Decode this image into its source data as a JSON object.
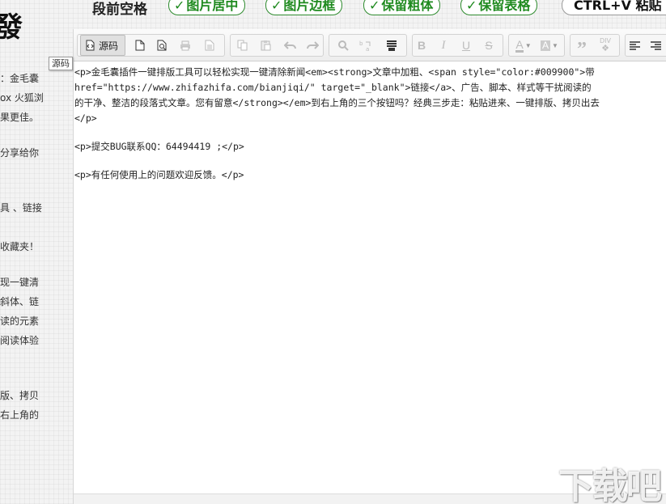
{
  "sidebar": {
    "logo_char": "發",
    "lines": [
      "：金毛囊",
      "ox 火狐浏",
      "果更佳。",
      "",
      "分享给你",
      "",
      "",
      "具 、链接",
      "",
      "收藏夹！",
      "",
      "现一键清",
      "斜体、链",
      "读的元素",
      "阅读体验",
      "",
      "",
      "版、拷贝",
      "右上角的"
    ]
  },
  "topbar": {
    "label": "段前空格",
    "options": [
      {
        "check": "✓",
        "label": "图片居中"
      },
      {
        "check": "✓",
        "label": "图片边框"
      },
      {
        "check": "✓",
        "label": "保留粗体"
      },
      {
        "check": "✓",
        "label": "保留表格"
      }
    ],
    "ctrl_label": "CTRL+V 粘贴"
  },
  "toolbar": {
    "source_label": "源码",
    "tooltip": "源码",
    "text_color_letter": "A",
    "bg_color_letter": "A",
    "bold_letter": "B",
    "italic_letter": "I",
    "underline_letter": "U",
    "strike_letter": "S",
    "quote_glyph": "”",
    "div_glyph": "DIV"
  },
  "editor": {
    "lines": [
      "<p>金毛囊插件一键排版工具可以轻松实现一键清除新闻<em><strong>文章中加粗、<span style=\"color:#009900\">带",
      "href=\"https://www.zhifazhifa.com/bianjiqi/\" target=\"_blank\">链接</a>、广告、脚本、样式等干扰阅读的",
      "的干净、整洁的段落式文章。您有留意</strong></em>到右上角的三个按钮吗？经典三步走：粘贴进来、一键排版、拷贝出去",
      "</p>",
      "",
      "<p>提交BUG联系QQ：64494419 ;</p>",
      "",
      "<p>有任何使用上的问题欢迎反馈。</p>"
    ]
  },
  "watermark": "下载吧",
  "colors": {
    "accent_green": "#1f8a1f",
    "toolbar_bg": "#ededed"
  }
}
